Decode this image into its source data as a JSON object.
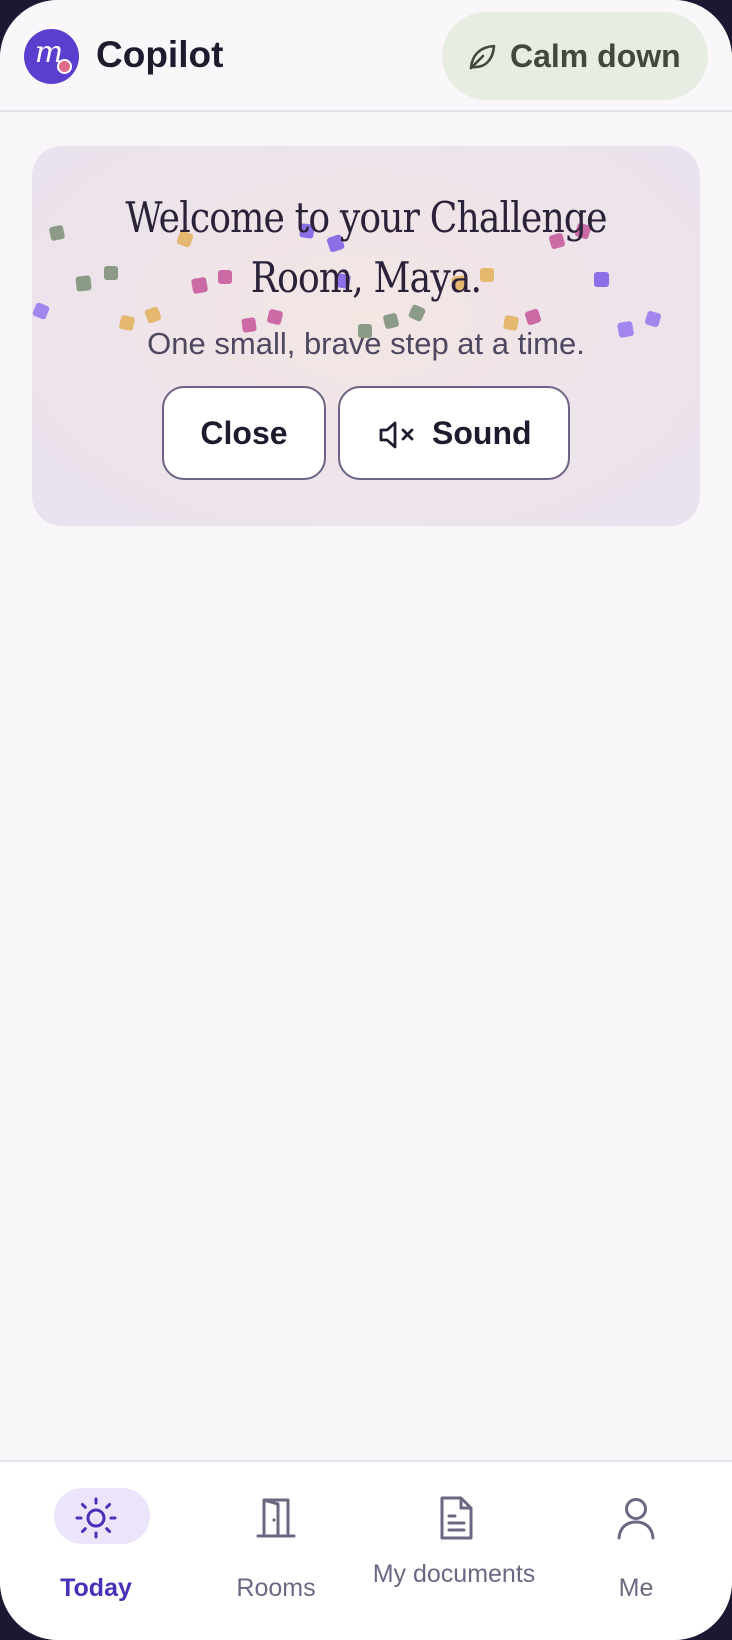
{
  "header": {
    "logo_letter": "m",
    "app_name": "Copilot",
    "calm_button_label": "Calm down"
  },
  "welcome_card": {
    "title": "Welcome to your Challenge Room, Maya.",
    "subtitle": "One small, brave step at a time.",
    "close_label": "Close",
    "sound_label": "Sound",
    "sound_muted": true
  },
  "bottom_nav": {
    "items": [
      {
        "label": "Today",
        "icon": "sun-icon",
        "active": true
      },
      {
        "label": "Rooms",
        "icon": "door-icon",
        "active": false
      },
      {
        "label": "My documents",
        "icon": "document-icon",
        "active": false
      },
      {
        "label": "Me",
        "icon": "person-icon",
        "active": false
      }
    ]
  },
  "colors": {
    "accent": "#5a3fcf",
    "calm_bg": "#e8ede4",
    "active_nav": "#4a2fb8",
    "page_bg": "#f9f6fa"
  }
}
